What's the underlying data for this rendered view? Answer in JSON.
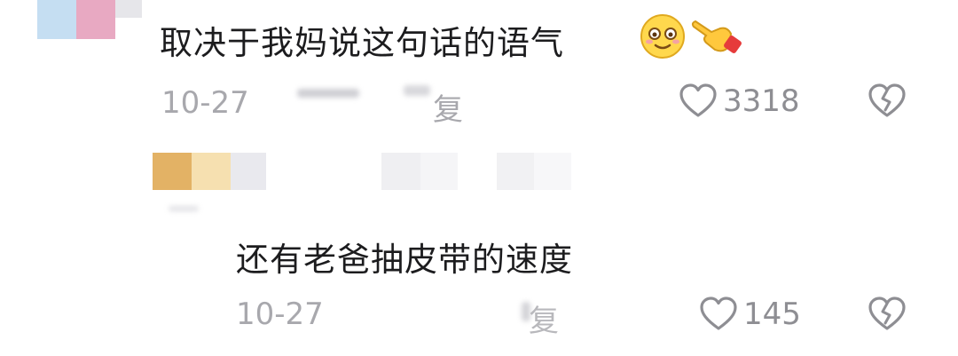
{
  "comments": [
    {
      "text": "取决于我妈说这句话的语气",
      "date": "10-27",
      "reply_label": "复",
      "like_count": "3318",
      "emojis": [
        "smiling-face-emoji",
        "pointing-hand-emoji"
      ]
    }
  ],
  "replies": [
    {
      "text": "还有老爸抽皮带的速度",
      "date": "10-27",
      "reply_label": "复",
      "like_count": "145"
    }
  ],
  "colors": {
    "text": "#1c1c1e",
    "meta": "#a8a8ad",
    "icon": "#8e8e93"
  }
}
